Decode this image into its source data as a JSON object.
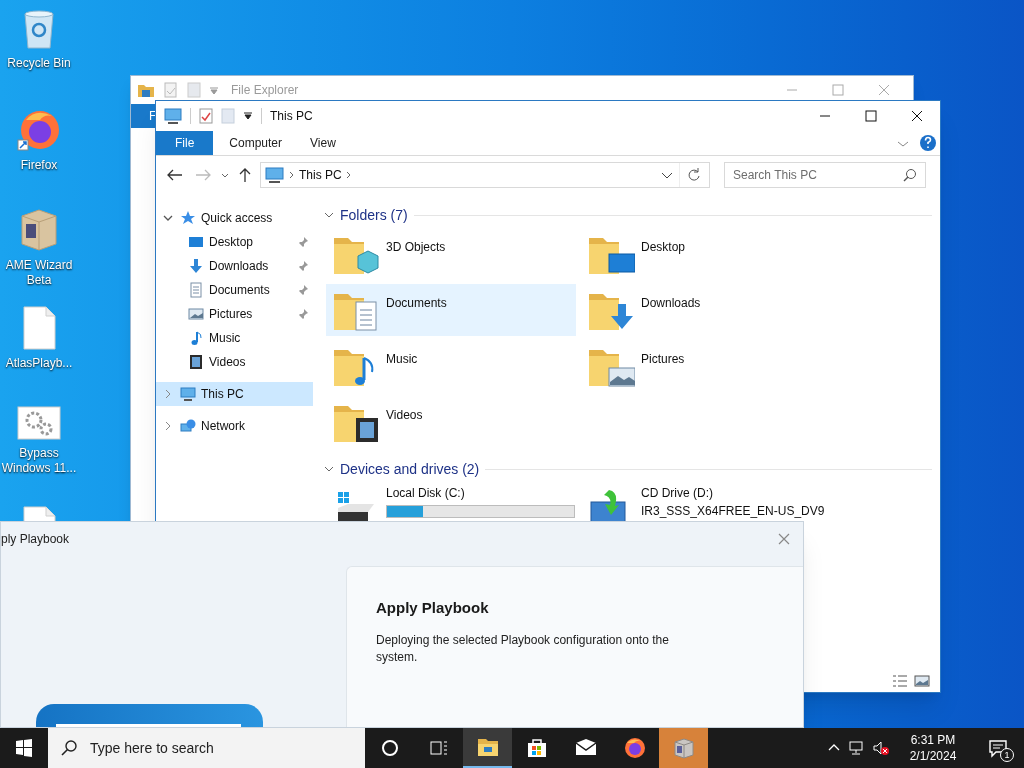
{
  "desktop_icons": [
    {
      "kind": "recycle",
      "label": "Recycle Bin"
    },
    {
      "kind": "firefox",
      "label": "Firefox"
    },
    {
      "kind": "box",
      "label": "AME Wizard Beta"
    },
    {
      "kind": "file",
      "label": "AtlasPlayb..."
    },
    {
      "kind": "gears",
      "label": "Bypass Windows 11..."
    },
    {
      "kind": "file"
    }
  ],
  "back_window": {
    "title": "File Explorer",
    "ribbon_tab": "F"
  },
  "explorer": {
    "title": "This PC",
    "ribbon_tabs": [
      {
        "label": "File",
        "selected": true
      },
      {
        "label": "Computer",
        "selected": false
      },
      {
        "label": "View",
        "selected": false
      }
    ],
    "address": [
      "This PC"
    ],
    "search_placeholder": "Search This PC",
    "nav": [
      {
        "label": "Quick access",
        "kind": "star",
        "expanded": true,
        "selected": false,
        "children": [
          {
            "label": "Desktop",
            "kind": "desktop",
            "pinned": true,
            "selected": false
          },
          {
            "label": "Downloads",
            "kind": "downloads",
            "pinned": true,
            "selected": false
          },
          {
            "label": "Documents",
            "kind": "documents",
            "pinned": true,
            "selected": false
          },
          {
            "label": "Pictures",
            "kind": "pictures",
            "pinned": true,
            "selected": false
          },
          {
            "label": "Music",
            "kind": "music",
            "pinned": false,
            "selected": false
          },
          {
            "label": "Videos",
            "kind": "videos",
            "pinned": false,
            "selected": false
          }
        ]
      },
      {
        "label": "This PC",
        "kind": "pc",
        "expanded": false,
        "selected": true
      },
      {
        "label": "Network",
        "kind": "network",
        "expanded": false,
        "selected": false
      }
    ],
    "folders": {
      "title": "Folders (7)",
      "expanded": true,
      "items": [
        {
          "name": "3D Objects",
          "kind": "objects",
          "hovered": false
        },
        {
          "name": "Desktop",
          "kind": "desktop",
          "hovered": false
        },
        {
          "name": "Documents",
          "kind": "documents",
          "hovered": true
        },
        {
          "name": "Downloads",
          "kind": "downloads",
          "hovered": false
        },
        {
          "name": "Music",
          "kind": "music",
          "hovered": false
        },
        {
          "name": "Pictures",
          "kind": "pictures",
          "hovered": false
        },
        {
          "name": "Videos",
          "kind": "videos",
          "hovered": false
        }
      ]
    },
    "drives": {
      "title": "Devices and drives (2)",
      "expanded": true,
      "items": [
        {
          "name": "Local Disk (C:)",
          "kind": "disk",
          "level": 0.19
        },
        {
          "name": "CD Drive (D:)",
          "kind": "cd",
          "volume": "IR3_SSS_X64FREE_EN-US_DV9"
        }
      ]
    }
  },
  "dialog": {
    "title": "ply Playbook",
    "heading": "Apply Playbook",
    "body": "Deploying the selected Playbook configuration onto the system."
  },
  "taskbar": {
    "search_placeholder": "Type here to search",
    "apps": [
      {
        "kind": "cortana",
        "active": false,
        "flashing": false
      },
      {
        "kind": "taskview",
        "active": false,
        "flashing": false
      },
      {
        "kind": "explorer",
        "active": true,
        "flashing": false
      },
      {
        "kind": "store",
        "active": false,
        "flashing": false
      },
      {
        "kind": "mail",
        "active": false,
        "flashing": false
      },
      {
        "kind": "firefox",
        "active": false,
        "flashing": false
      },
      {
        "kind": "ame",
        "active": false,
        "flashing": true
      }
    ],
    "muted": true,
    "time": "6:31 PM",
    "date": "2/1/2024",
    "notifications": "1"
  }
}
